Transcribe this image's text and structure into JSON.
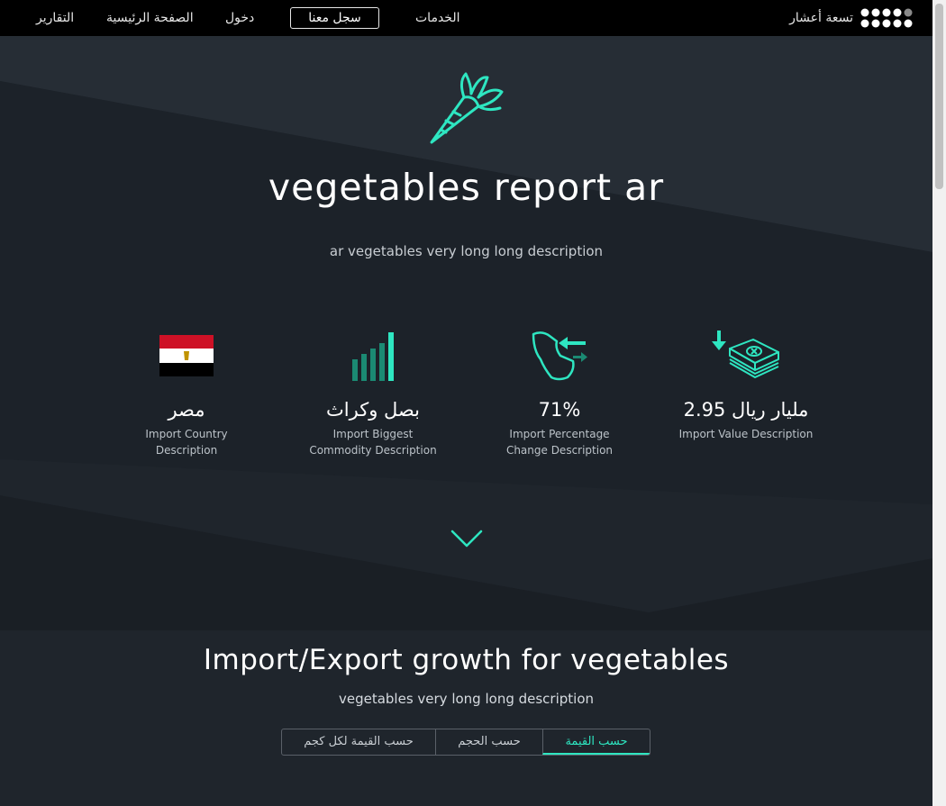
{
  "nav": {
    "reports": "التقارير",
    "home": "الصفحة الرئيسية",
    "login": "دخول",
    "register": "سجل معنا",
    "services": "الخدمات",
    "brand": "تسعة أعشار"
  },
  "hero": {
    "icon": "carrot-icon",
    "title": "vegetables report ar",
    "description": "ar vegetables very long long description"
  },
  "stats": [
    {
      "icon": "egypt-flag-icon",
      "value": "مصر",
      "label_line1": "Import Country",
      "label_line2": "Description"
    },
    {
      "icon": "bar-chart-icon",
      "value": "بصل وكراث",
      "label_line1": "Import Biggest",
      "label_line2": "Commodity Description"
    },
    {
      "icon": "saudi-map-exchange-icon",
      "value": "71%",
      "label_line1": "Import Percentage",
      "label_line2": "Change Description"
    },
    {
      "icon": "money-stack-icon",
      "value": "2.95 مليار ريال",
      "label_line1": "Import Value Description",
      "label_line2": ""
    }
  ],
  "growth": {
    "title": "Import/Export growth for vegetables",
    "description": "vegetables very long long description",
    "tabs": [
      "حسب القيمة لكل كجم",
      "حسب الحجم",
      "حسب القيمة"
    ],
    "active_tab": "حسب القيمة"
  },
  "colors": {
    "accent": "#2ee6c1",
    "background": "#1f252c",
    "navbar": "#000000"
  }
}
